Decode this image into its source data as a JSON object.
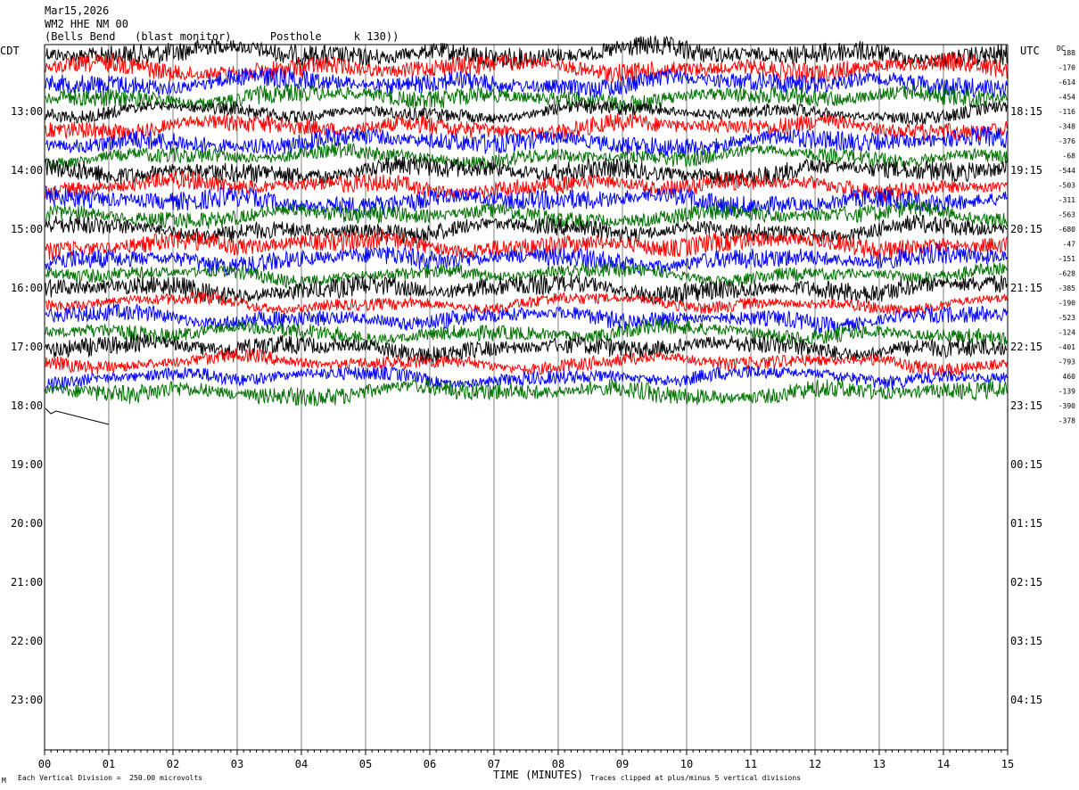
{
  "header": {
    "date": "Mar15,2026",
    "station": "WM2 HHE NM 00",
    "location": "(Bells Bend   (blast monitor)      Posthole     k 130))"
  },
  "left_timezone": "CDT",
  "right_timezone": "UTC",
  "dc_header": "DC",
  "footer": {
    "scale": "Each Vertical Division =  250.00 microvolts",
    "xlabel": "TIME (MINUTES)",
    "clip_note": "Traces clipped at plus/minus 5 vertical divisions",
    "corner_mark": "M"
  },
  "colors": {
    "trace_cycle": [
      "#000000",
      "#ff0000",
      "#0000ff",
      "#007000"
    ],
    "grid": "#808080",
    "frame": "#000000"
  },
  "chart_data": {
    "type": "line",
    "title": "Mar15,2026",
    "xlabel": "TIME (MINUTES)",
    "xlim": [
      0,
      15
    ],
    "x_ticks": [
      "00",
      "01",
      "02",
      "03",
      "04",
      "05",
      "06",
      "07",
      "08",
      "09",
      "10",
      "11",
      "12",
      "13",
      "14",
      "15"
    ],
    "left_hour_labels": [
      "13:00",
      "14:00",
      "15:00",
      "16:00",
      "17:00",
      "18:00",
      "19:00",
      "20:00",
      "21:00",
      "22:00",
      "23:00"
    ],
    "right_hour_labels": [
      "18:15",
      "19:15",
      "20:15",
      "21:15",
      "22:15",
      "23:15",
      "00:15",
      "01:15",
      "02:15",
      "03:15",
      "04:15"
    ],
    "rows_per_hour": 4,
    "row_count": 52,
    "recorded_rows": 25,
    "last_row_minutes": 1.0,
    "dc_offsets": [
      188,
      -170,
      -614,
      -454,
      -116,
      -348,
      -376,
      -68,
      -544,
      -503,
      -311,
      -563,
      -680,
      -47,
      -151,
      -628,
      -385,
      -190,
      -523,
      -124,
      -401,
      -793,
      460,
      -139,
      -390,
      -378
    ],
    "series_colors": [
      "black",
      "red",
      "blue",
      "green"
    ],
    "amplitude_units": "microvolts",
    "vertical_division_microvolts": 250,
    "clip_divisions": 5
  }
}
